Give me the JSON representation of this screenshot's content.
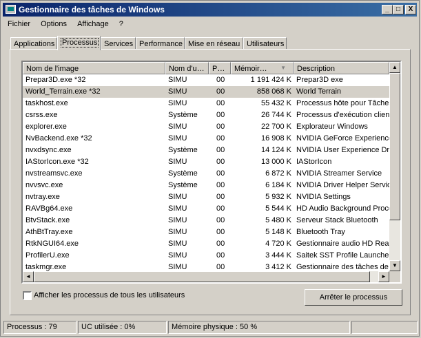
{
  "window": {
    "title": "Gestionnaire des tâches de Windows"
  },
  "titlebar_buttons": {
    "minimize": "_",
    "maximize": "□",
    "close": "X"
  },
  "menu": [
    "Fichier",
    "Options",
    "Affichage",
    "?"
  ],
  "tabs": [
    {
      "label": "Applications",
      "active": false
    },
    {
      "label": "Processus",
      "active": true
    },
    {
      "label": "Services",
      "active": false
    },
    {
      "label": "Performance",
      "active": false
    },
    {
      "label": "Mise en réseau",
      "active": false
    },
    {
      "label": "Utilisateurs",
      "active": false
    }
  ],
  "table": {
    "columns": [
      "Nom de l'image",
      "Nom d'u…",
      "P…",
      "Mémoir…",
      "Description"
    ],
    "sort_indicator": "▼",
    "rows": [
      [
        "Prepar3D.exe *32",
        "SIMU",
        "00",
        "1 191 424 K",
        "Prepar3D exe"
      ],
      [
        "World_Terrain.exe *32",
        "SIMU",
        "00",
        "858 068 K",
        "World Terrain"
      ],
      [
        "taskhost.exe",
        "SIMU",
        "00",
        "55 432 K",
        "Processus hôte pour Tâches Windows"
      ],
      [
        "csrss.exe",
        "Système",
        "00",
        "26 744 K",
        "Processus d'exécution client-serveur"
      ],
      [
        "explorer.exe",
        "SIMU",
        "00",
        "22 700 K",
        "Explorateur Windows"
      ],
      [
        "NvBackend.exe *32",
        "SIMU",
        "00",
        "16 908 K",
        "NVIDIA GeForce Experience Backend"
      ],
      [
        "nvxdsync.exe",
        "Système",
        "00",
        "14 124 K",
        "NVIDIA User Experience Driver Component"
      ],
      [
        "IAStorIcon.exe *32",
        "SIMU",
        "00",
        "13 000 K",
        "IAStorIcon"
      ],
      [
        "nvstreamsvc.exe",
        "Système",
        "00",
        "6 872 K",
        "NVIDIA Streamer Service"
      ],
      [
        "nvvsvc.exe",
        "Système",
        "00",
        "6 184 K",
        "NVIDIA Driver Helper Service"
      ],
      [
        "nvtray.exe",
        "SIMU",
        "00",
        "5 932 K",
        "NVIDIA Settings"
      ],
      [
        "RAVBg64.exe",
        "SIMU",
        "00",
        "5 544 K",
        "HD Audio Background Process"
      ],
      [
        "BtvStack.exe",
        "SIMU",
        "00",
        "5 480 K",
        "Serveur Stack Bluetooth"
      ],
      [
        "AthBtTray.exe",
        "SIMU",
        "00",
        "5 148 K",
        "Bluetooth Tray"
      ],
      [
        "RtkNGUI64.exe",
        "SIMU",
        "00",
        "4 720 K",
        "Gestionnaire audio HD Realtek"
      ],
      [
        "ProfilerU.exe",
        "SIMU",
        "00",
        "3 444 K",
        "Saitek SST Profile Launcher"
      ],
      [
        "taskmgr.exe",
        "SIMU",
        "00",
        "3 412 K",
        "Gestionnaire des tâches de Windows"
      ]
    ],
    "selected_row_index": 1
  },
  "scroll": {
    "up": "▲",
    "down": "▼",
    "left": "◄",
    "right": "►"
  },
  "show_all_users": {
    "label": "Afficher les processus de tous les utilisateurs",
    "checked": false
  },
  "end_process_button": "Arrêter le processus",
  "status": {
    "processes": "Processus : 79",
    "cpu": "UC utilisée : 0%",
    "memory": "Mémoire physique : 50 %"
  }
}
